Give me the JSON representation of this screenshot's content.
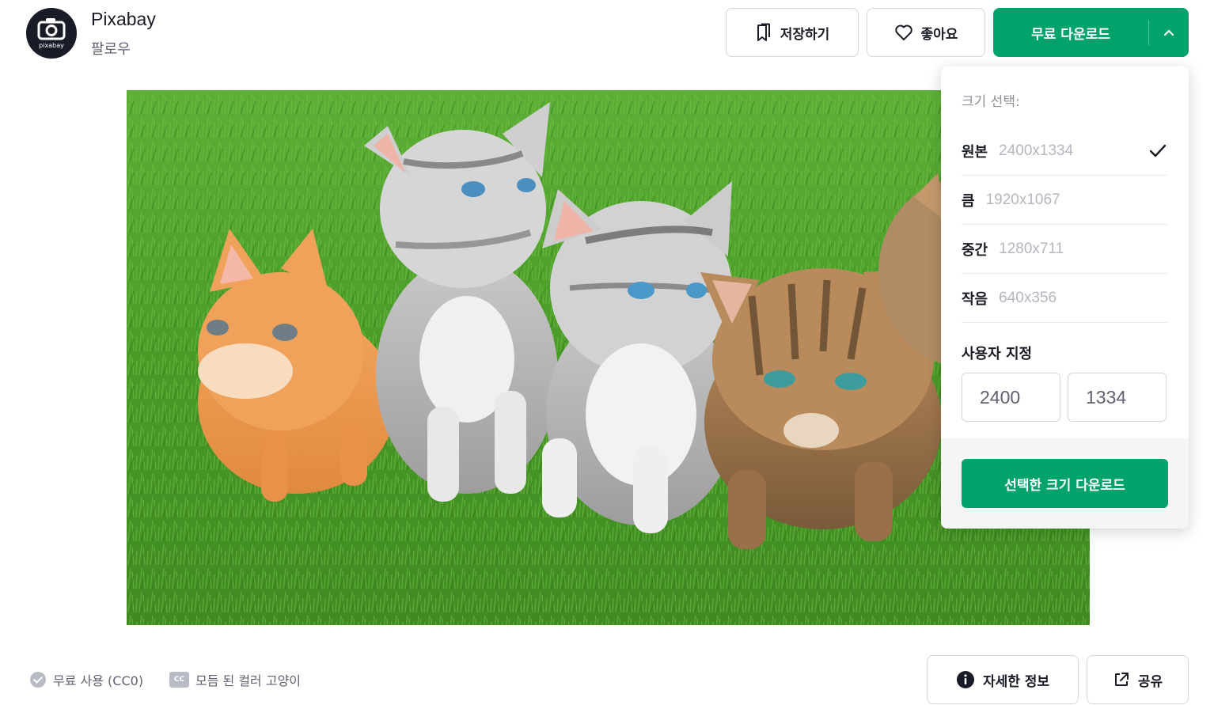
{
  "author": {
    "name": "Pixabay",
    "follow_label": "팔로우",
    "avatar_text": "pixabay"
  },
  "actions": {
    "save_label": "저장하기",
    "like_label": "좋아요",
    "download_label": "무료 다운로드"
  },
  "photo": {
    "subject": "kittens on grass"
  },
  "download_menu": {
    "title": "크기 선택:",
    "sizes": [
      {
        "name": "원본",
        "dims": "2400x1334",
        "selected": true
      },
      {
        "name": "큼",
        "dims": "1920x1067",
        "selected": false
      },
      {
        "name": "중간",
        "dims": "1280x711",
        "selected": false
      },
      {
        "name": "작음",
        "dims": "640x356",
        "selected": false
      }
    ],
    "custom_label": "사용자 지정",
    "custom_width": "2400",
    "custom_height": "1334",
    "download_selected_label": "선택한 크기 다운로드"
  },
  "footer": {
    "license_label": "무료 사용 (CC0)",
    "cc_badge": "CC",
    "tags_label": "모듬 된 컬러 고양이",
    "info_label": "자세한 정보",
    "share_label": "공유"
  },
  "colors": {
    "accent": "#02a26e",
    "text_primary": "#191b26",
    "text_muted": "#8e909c"
  }
}
